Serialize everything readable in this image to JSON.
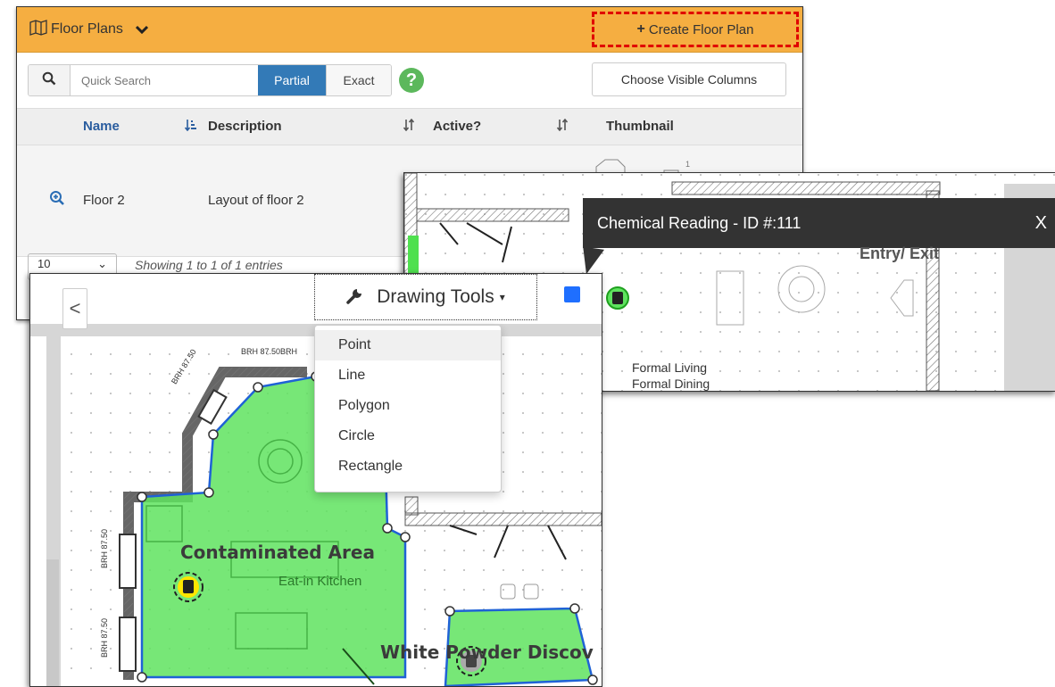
{
  "floor_plans": {
    "title": "Floor Plans",
    "create_label": "Create Floor Plan",
    "search": {
      "placeholder": "Quick Search",
      "partial_label": "Partial",
      "exact_label": "Exact",
      "help_glyph": "?"
    },
    "choose_columns_label": "Choose Visible Columns",
    "columns": [
      "Name",
      "Description",
      "Active?",
      "Thumbnail"
    ],
    "rows": [
      {
        "name": "Floor 2",
        "description": "Layout of floor 2"
      }
    ],
    "footer": {
      "page_size": "10",
      "showing_text": "Showing 1 to 1 of 1 entries"
    }
  },
  "reading_map": {
    "tooltip_title": "Chemical Reading - ID #:111",
    "tooltip_close": "X",
    "room_labels": [
      "Entry/ Exit",
      "Formal Living",
      "Formal Dining"
    ]
  },
  "drawing": {
    "back_glyph": "<",
    "tools_label": "Drawing Tools",
    "tools_caret": "▾",
    "accent_color": "#1f6fff",
    "menu_items": [
      "Point",
      "Line",
      "Polygon",
      "Circle",
      "Rectangle"
    ],
    "area_labels": [
      "Contaminated Area",
      "Eat-in Kitchen",
      "White Powder Discov"
    ],
    "dimension_labels": [
      "BRH 87.50BRH",
      "BRH 87.50",
      "BRH 87.50",
      "BRH 87.50"
    ]
  },
  "colors": {
    "header_orange": "#f5ae41",
    "partial_blue": "#337ab7",
    "help_green": "#5cb85c",
    "area_green": "#5fe35f",
    "polygon_blue": "#1f62d6",
    "marker_yellow": "#ffe600"
  },
  "icons": [
    "map-icon",
    "chevron-down-icon",
    "plus-icon",
    "search-icon",
    "help-icon",
    "sort-icon",
    "zoom-in-icon",
    "wrench-icon",
    "chemical-sensor-icon"
  ]
}
